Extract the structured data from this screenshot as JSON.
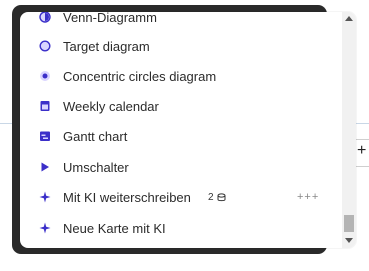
{
  "background": {
    "plus_button_label": "+"
  },
  "menu": {
    "items": [
      {
        "label": "Venn-Diagramm",
        "icon": "venn-icon"
      },
      {
        "label": "Target diagram",
        "icon": "target-icon"
      },
      {
        "label": "Concentric circles diagram",
        "icon": "concentric-circles-icon"
      },
      {
        "label": "Weekly calendar",
        "icon": "calendar-icon"
      },
      {
        "label": "Gantt chart",
        "icon": "gantt-icon"
      },
      {
        "label": "Umschalter",
        "icon": "toggle-play-icon"
      },
      {
        "label": "Mit KI weiterschreiben",
        "icon": "ai-sparkle-icon",
        "badge": "2",
        "shortcut": "+++"
      },
      {
        "label": "Neue Karte mit KI",
        "icon": "ai-sparkle-icon"
      }
    ]
  },
  "colors": {
    "accent": "#3b2fc9",
    "text": "#2b2b2b"
  }
}
